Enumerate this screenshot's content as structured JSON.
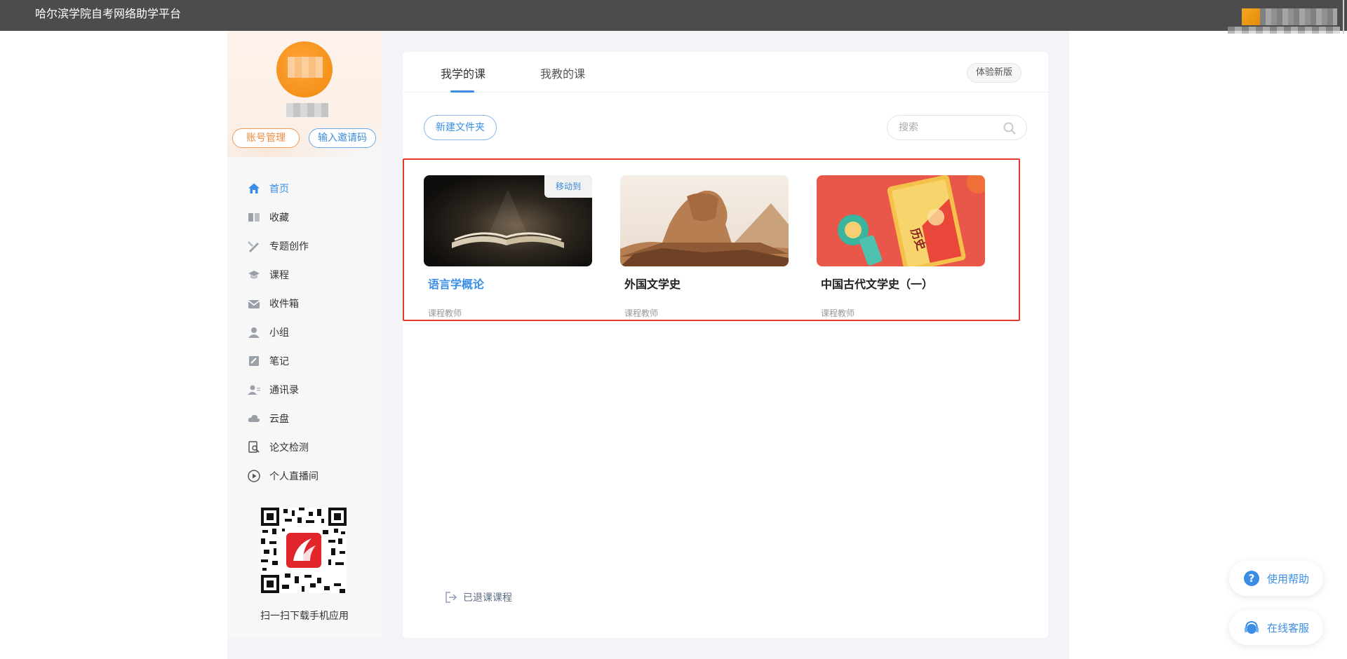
{
  "app": {
    "title": "哈尔滨学院自考网络助学平台"
  },
  "profile": {
    "account_button": "账号管理",
    "invite_button": "输入邀请码"
  },
  "nav": [
    {
      "label": "首页",
      "icon": "home-icon",
      "active": true
    },
    {
      "label": "收藏",
      "icon": "bookmark-icon"
    },
    {
      "label": "专题创作",
      "icon": "topic-create-icon"
    },
    {
      "label": "课程",
      "icon": "course-icon"
    },
    {
      "label": "收件箱",
      "icon": "inbox-icon"
    },
    {
      "label": "小组",
      "icon": "group-icon"
    },
    {
      "label": "笔记",
      "icon": "note-icon"
    },
    {
      "label": "通讯录",
      "icon": "contacts-icon"
    },
    {
      "label": "云盘",
      "icon": "cloud-icon"
    },
    {
      "label": "论文检测",
      "icon": "paper-check-icon"
    },
    {
      "label": "个人直播间",
      "icon": "live-icon"
    }
  ],
  "qr": {
    "caption": "扫一扫下载手机应用"
  },
  "tabs": [
    {
      "label": "我学的课",
      "active": true
    },
    {
      "label": "我教的课"
    }
  ],
  "new_version_button": "体验新版",
  "toolbar": {
    "new_folder_button": "新建文件夹",
    "search_placeholder": "搜索"
  },
  "courses": [
    {
      "name": "语言学概论",
      "teacher": "课程教师",
      "hover_action": "移动到",
      "highlighted_name": true
    },
    {
      "name": "外国文学史",
      "teacher": "课程教师"
    },
    {
      "name": "中国古代文学史（一）",
      "teacher": "课程教师",
      "cover_text": "历史"
    }
  ],
  "footer": {
    "withdrawn_courses": "已退课课程"
  },
  "floating": {
    "help": "使用帮助",
    "service": "在线客服"
  },
  "colors": {
    "accent": "#3a8ee6",
    "highlight_box": "#e23a2b",
    "account_button": "#f08a3e",
    "topbar": "#4c4c4c"
  }
}
